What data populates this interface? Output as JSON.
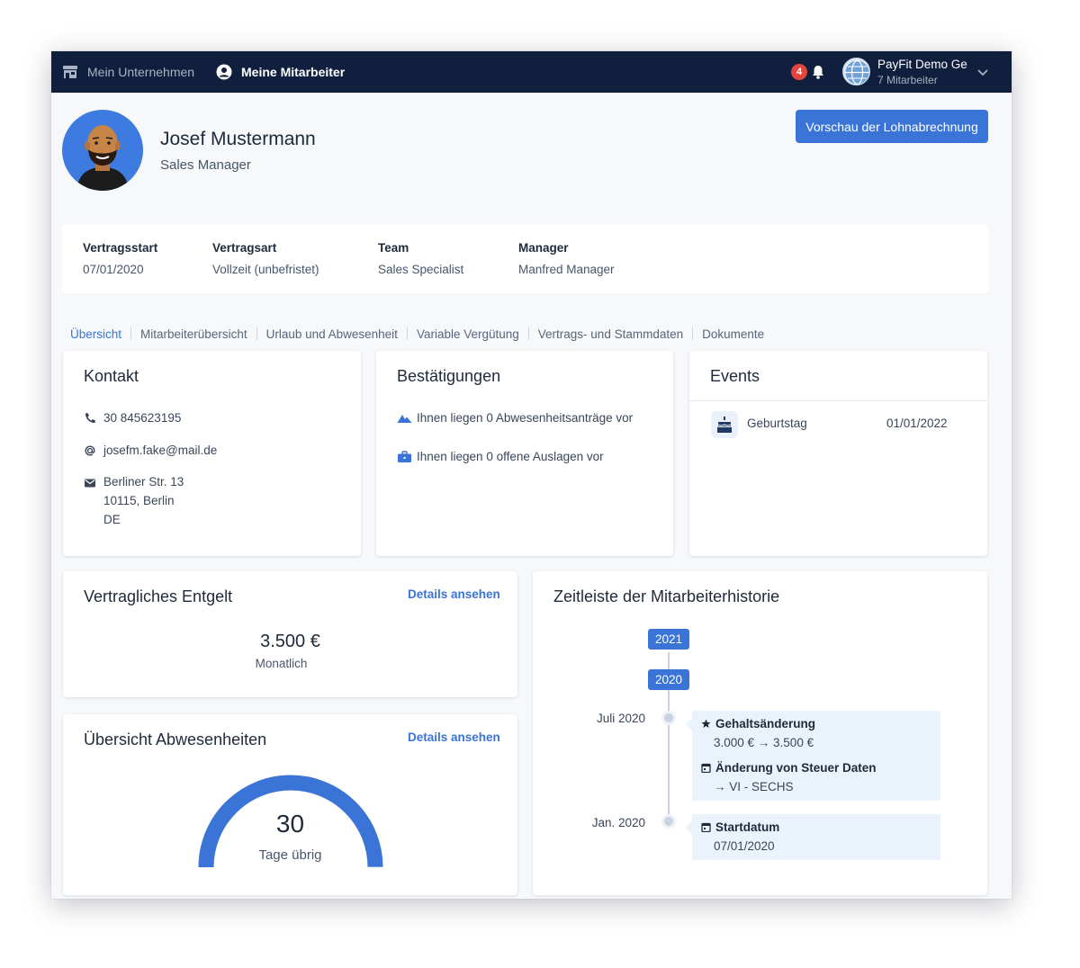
{
  "nav": {
    "company_label": "Mein Unternehmen",
    "employees_label": "Meine Mitarbeiter",
    "notification_count": "4",
    "account": {
      "name": "PayFit Demo Ge",
      "subtitle": "7 Mitarbeiter"
    }
  },
  "employee": {
    "name": "Josef Mustermann",
    "role": "Sales Manager",
    "preview_button": "Vorschau der Lohnabrechnung"
  },
  "contract": {
    "start_label": "Vertragsstart",
    "start_value": "07/01/2020",
    "type_label": "Vertragsart",
    "type_value": "Vollzeit (unbefristet)",
    "team_label": "Team",
    "team_value": "Sales Specialist",
    "manager_label": "Manager",
    "manager_value": "Manfred Manager"
  },
  "tabs": [
    {
      "label": "Übersicht",
      "active": true
    },
    {
      "label": "Mitarbeiterübersicht",
      "active": false
    },
    {
      "label": "Urlaub und Abwesenheit",
      "active": false
    },
    {
      "label": "Variable Vergütung",
      "active": false
    },
    {
      "label": "Vertrags- und Stammdaten",
      "active": false
    },
    {
      "label": "Dokumente",
      "active": false
    }
  ],
  "contact": {
    "title": "Kontakt",
    "phone": "30 845623195",
    "email": "josefm.fake@mail.de",
    "address_line1": "Berliner Str. 13",
    "address_line2": "10115, Berlin",
    "address_line3": "DE"
  },
  "confirmations": {
    "title": "Bestätigungen",
    "absence_text": "Ihnen liegen 0 Abwesenheitsanträge vor",
    "expense_text": "Ihnen liegen 0 offene Auslagen vor"
  },
  "events": {
    "title": "Events",
    "items": [
      {
        "icon": "cake-icon",
        "label": "Geburtstag",
        "date": "01/01/2022"
      }
    ]
  },
  "salary": {
    "title": "Vertragliches Entgelt",
    "details_link": "Details ansehen",
    "amount": "3.500 €",
    "period": "Monatlich"
  },
  "absences": {
    "title": "Übersicht Abwesenheiten",
    "details_link": "Details ansehen",
    "days_left": "30",
    "days_left_label": "Tage übrig",
    "remaining_fraction": 1.0
  },
  "timeline": {
    "title": "Zeitleiste der Mitarbeiterhistorie",
    "years": [
      "2021",
      "2020"
    ],
    "groups": [
      {
        "date": "Juli 2020",
        "entries": [
          {
            "icon": "star-icon",
            "title": "Gehaltsänderung",
            "detail": "3.000 € → 3.500 €"
          },
          {
            "icon": "calendar-icon",
            "title": "Änderung von Steuer Daten",
            "detail": "→ VI - SECHS"
          }
        ]
      },
      {
        "date": "Jan. 2020",
        "entries": [
          {
            "icon": "calendar-icon",
            "title": "Startdatum",
            "detail": "07/01/2020"
          }
        ]
      }
    ]
  },
  "colors": {
    "nav_bg": "#0f1f3d",
    "accent": "#3a74d6",
    "badge": "#e2453c",
    "page_bg": "#f6f8fa"
  }
}
